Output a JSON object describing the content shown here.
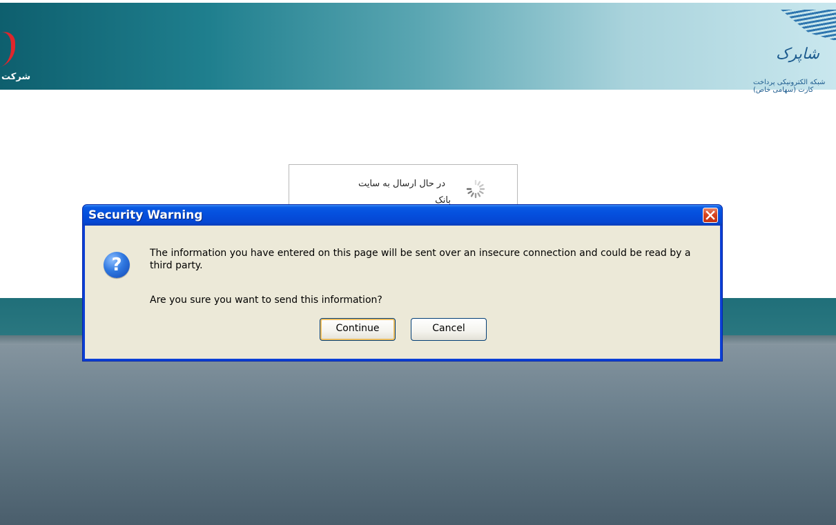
{
  "banner": {
    "left_logo_text": "شرکت",
    "right_logo_name": "شاپرک",
    "right_logo_sub": "شبکه الکترونیکی پرداخت کارت (سهامی خاص)"
  },
  "loading": {
    "line1": "در حال ارسال به سایت",
    "line2": "بانک"
  },
  "dialog": {
    "title": "Security Warning",
    "message": "The information you have entered on this page will be sent over an insecure connection and could be read by a third party.",
    "question": "Are you sure you want to send this information?",
    "continue_label": "Continue",
    "cancel_label": "Cancel",
    "icon": "question-icon"
  },
  "colors": {
    "titlebar": "#0550de",
    "dialog_body": "#ece9d8",
    "banner_dark": "#0e5f6e",
    "band": "#206f79"
  }
}
